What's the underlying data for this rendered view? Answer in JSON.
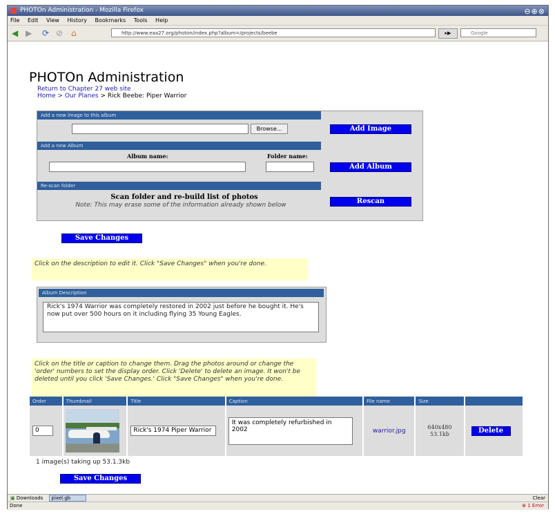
{
  "window": {
    "title": "PHOTOn Administration - Mozilla Firefox",
    "controls": "⊖⊕⊗"
  },
  "menu": [
    "File",
    "Edit",
    "View",
    "History",
    "Bookmarks",
    "Tools",
    "Help"
  ],
  "nav": {
    "url": "http://www.eaa27.org/photon/index.php?album=/projects/beebe",
    "search_placeholder": "Google"
  },
  "page": {
    "heading": "PHOTOn Administration",
    "return_link": "Return to Chapter 27 web site",
    "breadcrumb": {
      "home": "Home",
      "sep1": " > ",
      "planes": "Our Planes",
      "sep2": " > ",
      "current": "Rick Beebe: Piper Warrior"
    }
  },
  "add_image": {
    "header": "Add a new image to this album",
    "browse_label": "Browse...",
    "button": "Add Image"
  },
  "add_album": {
    "header": "Add a new Album",
    "album_name_label": "Album name:",
    "folder_name_label": "Folder name:",
    "button": "Add Album"
  },
  "rescan": {
    "header": "Re-scan folder",
    "title": "Scan folder and re-build list of photos",
    "note": "Note: This may erase some of the information already shown below",
    "button": "Rescan"
  },
  "save_label": "Save Changes",
  "hint_description": "Click on the description to edit it. Click \"Save Changes\" when you're done.",
  "album_description": {
    "header": "Album Description",
    "text": "Rick's 1974 Warrior was completely restored in 2002 just before he bought it. He's now put over 500 hours on it including flying 35 Young Eagles."
  },
  "hint_photos": "Click on the title or caption to change them. Drag the photos around or change the 'order' numbers to set the display order. Click 'Delete' to delete an image. It won't be deleted until you click 'Save Changes.' Click \"Save Changes\" when you're done.",
  "photo_table": {
    "columns": [
      "Order",
      "Thumbnail",
      "Title",
      "Caption",
      "File name",
      "Size",
      ""
    ],
    "rows": [
      {
        "order": "0",
        "title": "Rick's 1974 Piper Warrior",
        "caption": "It was completely refurbished in 2002",
        "file_name": "warrior.jpg",
        "dimensions": "640x480",
        "size": "53.1kb",
        "delete_label": "Delete"
      }
    ]
  },
  "summary": "1 image(s) taking up 53.1.3kb",
  "downloads_bar": {
    "downloads": "Downloads",
    "file": "pixel.gb"
  },
  "status": {
    "left": "Done",
    "errors": "1 Error",
    "close": "Clear"
  },
  "colors": {
    "header_blue": "#2f5f9c",
    "button_blue": "#0000ee",
    "hint_yellow": "#ffffc8",
    "panel_gray": "#dddddd"
  }
}
